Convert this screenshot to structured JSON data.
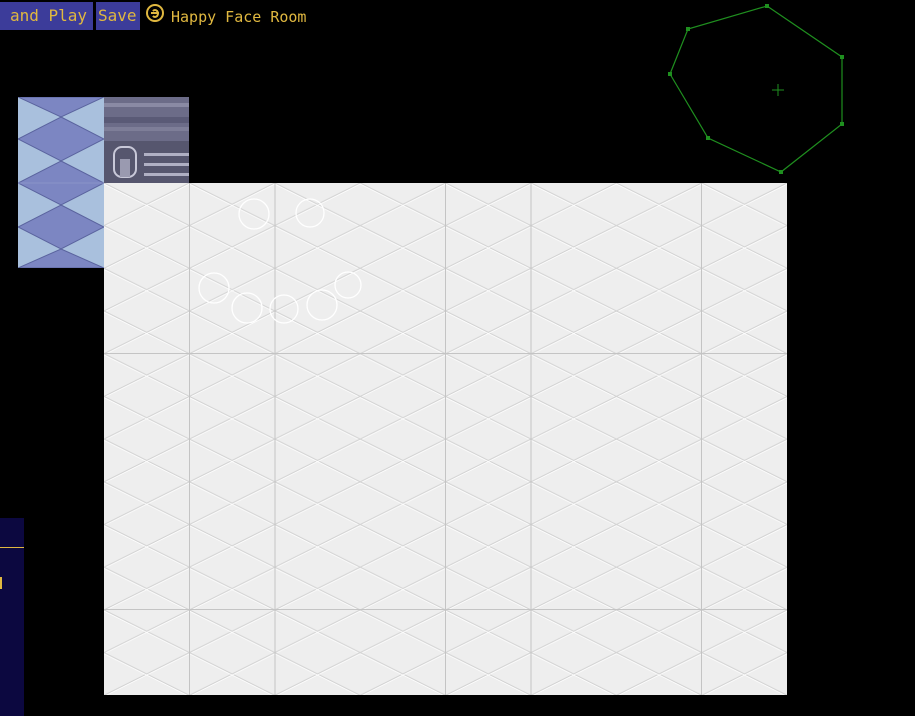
{
  "toolbar": {
    "play_label": "and Play",
    "save_label": "Save"
  },
  "room": {
    "name": "Happy Face Room",
    "icon": "smiley-icon"
  },
  "colors": {
    "background": "#000000",
    "button_bg": "#3c3c9a",
    "text_accent": "#e0b840",
    "floor": "#eeeeee",
    "diamond_tile": "#a9c0dd",
    "nav_outline": "#1f8f1f"
  },
  "minimap": {
    "icon": "crosshair-icon"
  }
}
